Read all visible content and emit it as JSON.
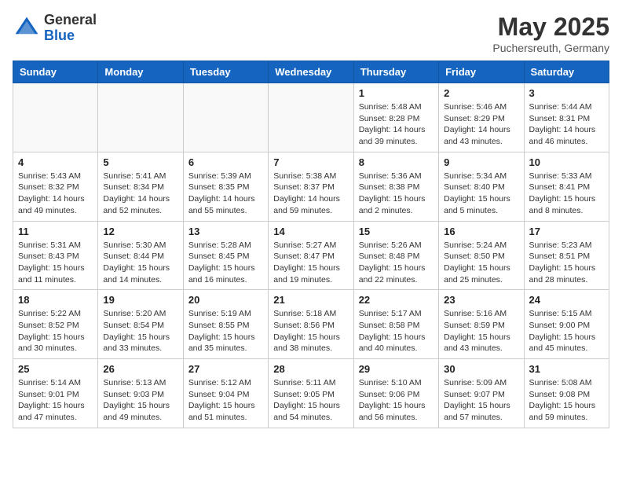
{
  "header": {
    "logo_general": "General",
    "logo_blue": "Blue",
    "month_year": "May 2025",
    "location": "Puchersreuth, Germany"
  },
  "weekdays": [
    "Sunday",
    "Monday",
    "Tuesday",
    "Wednesday",
    "Thursday",
    "Friday",
    "Saturday"
  ],
  "weeks": [
    [
      {
        "day": "",
        "info": ""
      },
      {
        "day": "",
        "info": ""
      },
      {
        "day": "",
        "info": ""
      },
      {
        "day": "",
        "info": ""
      },
      {
        "day": "1",
        "info": "Sunrise: 5:48 AM\nSunset: 8:28 PM\nDaylight: 14 hours\nand 39 minutes."
      },
      {
        "day": "2",
        "info": "Sunrise: 5:46 AM\nSunset: 8:29 PM\nDaylight: 14 hours\nand 43 minutes."
      },
      {
        "day": "3",
        "info": "Sunrise: 5:44 AM\nSunset: 8:31 PM\nDaylight: 14 hours\nand 46 minutes."
      }
    ],
    [
      {
        "day": "4",
        "info": "Sunrise: 5:43 AM\nSunset: 8:32 PM\nDaylight: 14 hours\nand 49 minutes."
      },
      {
        "day": "5",
        "info": "Sunrise: 5:41 AM\nSunset: 8:34 PM\nDaylight: 14 hours\nand 52 minutes."
      },
      {
        "day": "6",
        "info": "Sunrise: 5:39 AM\nSunset: 8:35 PM\nDaylight: 14 hours\nand 55 minutes."
      },
      {
        "day": "7",
        "info": "Sunrise: 5:38 AM\nSunset: 8:37 PM\nDaylight: 14 hours\nand 59 minutes."
      },
      {
        "day": "8",
        "info": "Sunrise: 5:36 AM\nSunset: 8:38 PM\nDaylight: 15 hours\nand 2 minutes."
      },
      {
        "day": "9",
        "info": "Sunrise: 5:34 AM\nSunset: 8:40 PM\nDaylight: 15 hours\nand 5 minutes."
      },
      {
        "day": "10",
        "info": "Sunrise: 5:33 AM\nSunset: 8:41 PM\nDaylight: 15 hours\nand 8 minutes."
      }
    ],
    [
      {
        "day": "11",
        "info": "Sunrise: 5:31 AM\nSunset: 8:43 PM\nDaylight: 15 hours\nand 11 minutes."
      },
      {
        "day": "12",
        "info": "Sunrise: 5:30 AM\nSunset: 8:44 PM\nDaylight: 15 hours\nand 14 minutes."
      },
      {
        "day": "13",
        "info": "Sunrise: 5:28 AM\nSunset: 8:45 PM\nDaylight: 15 hours\nand 16 minutes."
      },
      {
        "day": "14",
        "info": "Sunrise: 5:27 AM\nSunset: 8:47 PM\nDaylight: 15 hours\nand 19 minutes."
      },
      {
        "day": "15",
        "info": "Sunrise: 5:26 AM\nSunset: 8:48 PM\nDaylight: 15 hours\nand 22 minutes."
      },
      {
        "day": "16",
        "info": "Sunrise: 5:24 AM\nSunset: 8:50 PM\nDaylight: 15 hours\nand 25 minutes."
      },
      {
        "day": "17",
        "info": "Sunrise: 5:23 AM\nSunset: 8:51 PM\nDaylight: 15 hours\nand 28 minutes."
      }
    ],
    [
      {
        "day": "18",
        "info": "Sunrise: 5:22 AM\nSunset: 8:52 PM\nDaylight: 15 hours\nand 30 minutes."
      },
      {
        "day": "19",
        "info": "Sunrise: 5:20 AM\nSunset: 8:54 PM\nDaylight: 15 hours\nand 33 minutes."
      },
      {
        "day": "20",
        "info": "Sunrise: 5:19 AM\nSunset: 8:55 PM\nDaylight: 15 hours\nand 35 minutes."
      },
      {
        "day": "21",
        "info": "Sunrise: 5:18 AM\nSunset: 8:56 PM\nDaylight: 15 hours\nand 38 minutes."
      },
      {
        "day": "22",
        "info": "Sunrise: 5:17 AM\nSunset: 8:58 PM\nDaylight: 15 hours\nand 40 minutes."
      },
      {
        "day": "23",
        "info": "Sunrise: 5:16 AM\nSunset: 8:59 PM\nDaylight: 15 hours\nand 43 minutes."
      },
      {
        "day": "24",
        "info": "Sunrise: 5:15 AM\nSunset: 9:00 PM\nDaylight: 15 hours\nand 45 minutes."
      }
    ],
    [
      {
        "day": "25",
        "info": "Sunrise: 5:14 AM\nSunset: 9:01 PM\nDaylight: 15 hours\nand 47 minutes."
      },
      {
        "day": "26",
        "info": "Sunrise: 5:13 AM\nSunset: 9:03 PM\nDaylight: 15 hours\nand 49 minutes."
      },
      {
        "day": "27",
        "info": "Sunrise: 5:12 AM\nSunset: 9:04 PM\nDaylight: 15 hours\nand 51 minutes."
      },
      {
        "day": "28",
        "info": "Sunrise: 5:11 AM\nSunset: 9:05 PM\nDaylight: 15 hours\nand 54 minutes."
      },
      {
        "day": "29",
        "info": "Sunrise: 5:10 AM\nSunset: 9:06 PM\nDaylight: 15 hours\nand 56 minutes."
      },
      {
        "day": "30",
        "info": "Sunrise: 5:09 AM\nSunset: 9:07 PM\nDaylight: 15 hours\nand 57 minutes."
      },
      {
        "day": "31",
        "info": "Sunrise: 5:08 AM\nSunset: 9:08 PM\nDaylight: 15 hours\nand 59 minutes."
      }
    ]
  ]
}
